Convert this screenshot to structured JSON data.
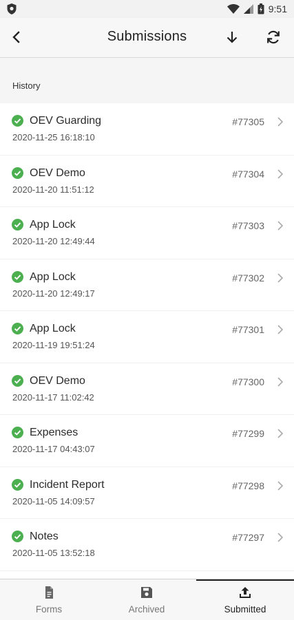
{
  "status_bar": {
    "time": "9:51"
  },
  "app_bar": {
    "title": "Submissions"
  },
  "section": {
    "title": "History"
  },
  "submissions": [
    {
      "name": "OEV Guarding",
      "date": "2020-11-25 16:18:10",
      "number": "#77305",
      "status": "submitted"
    },
    {
      "name": "OEV Demo",
      "date": "2020-11-20 11:51:12",
      "number": "#77304",
      "status": "submitted"
    },
    {
      "name": "App Lock",
      "date": "2020-11-20 12:49:44",
      "number": "#77303",
      "status": "submitted"
    },
    {
      "name": "App Lock",
      "date": "2020-11-20 12:49:17",
      "number": "#77302",
      "status": "submitted"
    },
    {
      "name": "App Lock",
      "date": "2020-11-19 19:51:24",
      "number": "#77301",
      "status": "submitted"
    },
    {
      "name": "OEV Demo",
      "date": "2020-11-17 11:02:42",
      "number": "#77300",
      "status": "submitted"
    },
    {
      "name": "Expenses",
      "date": "2020-11-17 04:43:07",
      "number": "#77299",
      "status": "submitted"
    },
    {
      "name": "Incident Report",
      "date": "2020-11-05 14:09:57",
      "number": "#77298",
      "status": "submitted"
    },
    {
      "name": "Notes",
      "date": "2020-11-05 13:52:18",
      "number": "#77297",
      "status": "submitted"
    }
  ],
  "bottom_nav": {
    "tabs": [
      {
        "label": "Forms",
        "icon": "document-icon",
        "active": false
      },
      {
        "label": "Archived",
        "icon": "save-icon",
        "active": false
      },
      {
        "label": "Submitted",
        "icon": "upload-icon",
        "active": true
      }
    ]
  },
  "colors": {
    "check_green": "#4caf50",
    "active_indicator": "#222222"
  }
}
